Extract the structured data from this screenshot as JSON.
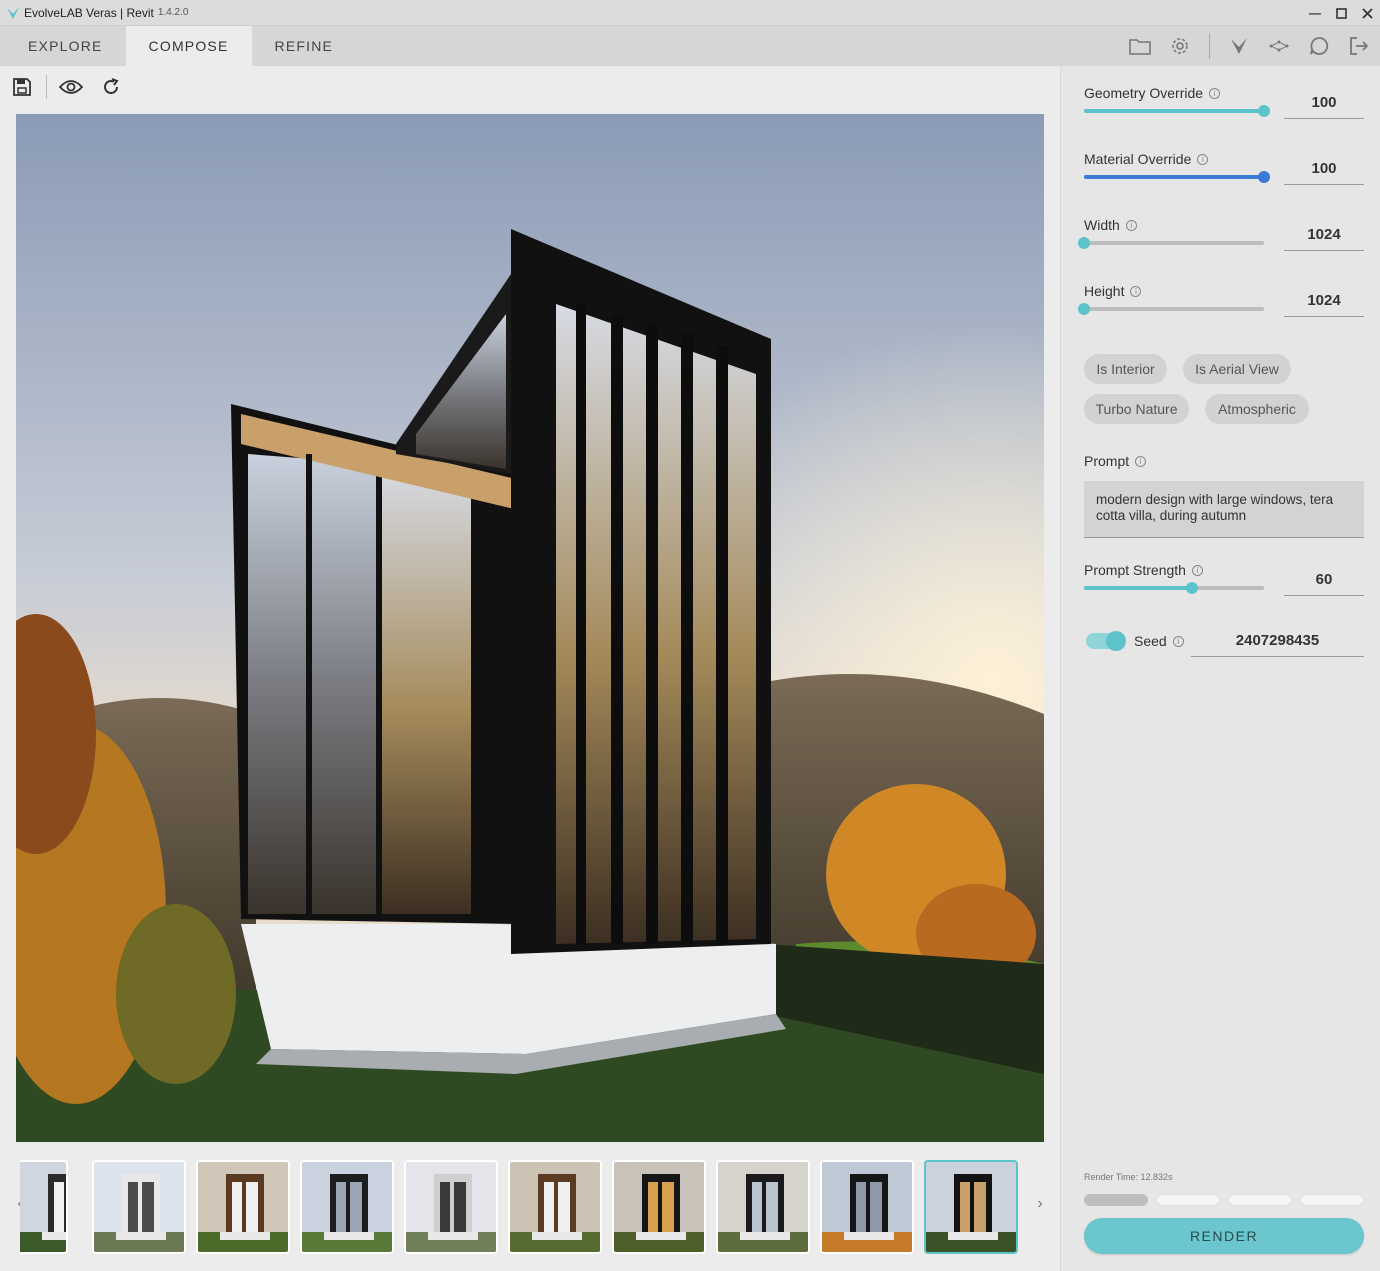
{
  "window": {
    "title": "EvolveLAB Veras | Revit",
    "version": "1.4.2.0",
    "controls": [
      "minimize-icon",
      "maximize-icon",
      "close-icon"
    ]
  },
  "tabs": [
    {
      "label": "EXPLORE",
      "active": false
    },
    {
      "label": "COMPOSE",
      "active": true
    },
    {
      "label": "REFINE",
      "active": false
    }
  ],
  "toolbar_icons": [
    "folder-icon",
    "gear-icon",
    "veras-logo-icon",
    "network-icon",
    "chat-icon",
    "logout-icon"
  ],
  "main_tools": [
    "save-icon",
    "eye-icon",
    "refresh-icon"
  ],
  "thumbnails": {
    "count_visible": 10,
    "selected_index": 9,
    "prev_label": "‹",
    "next_label": "›"
  },
  "panel": {
    "geometry_override": {
      "label": "Geometry Override",
      "value": "100",
      "level": 1.0,
      "color": "#5cc3cb"
    },
    "material_override": {
      "label": "Material Override",
      "value": "100",
      "level": 1.0,
      "color": "#3a7bd5"
    },
    "width": {
      "label": "Width",
      "value": "1024",
      "level": 0.0,
      "color": "#5cc3cb"
    },
    "height": {
      "label": "Height",
      "value": "1024",
      "level": 0.0,
      "color": "#5cc3cb"
    },
    "chips": [
      "Is Interior",
      "Is Aerial View",
      "Turbo Nature",
      "Atmospheric"
    ],
    "prompt": {
      "label": "Prompt",
      "value": "modern design with large windows, tera cotta villa, during autumn"
    },
    "prompt_strength": {
      "label": "Prompt Strength",
      "value": "60",
      "level": 0.6,
      "color": "#5cc3cb"
    },
    "seed": {
      "label": "Seed",
      "value": "2407298435",
      "enabled": true
    },
    "render_time": "Render Time: 12.832s",
    "progress": {
      "segments": 4,
      "done": 1
    },
    "render_button": "RENDER"
  },
  "colors": {
    "accent": "#5cc3cb",
    "material_accent": "#3a7bd5"
  }
}
